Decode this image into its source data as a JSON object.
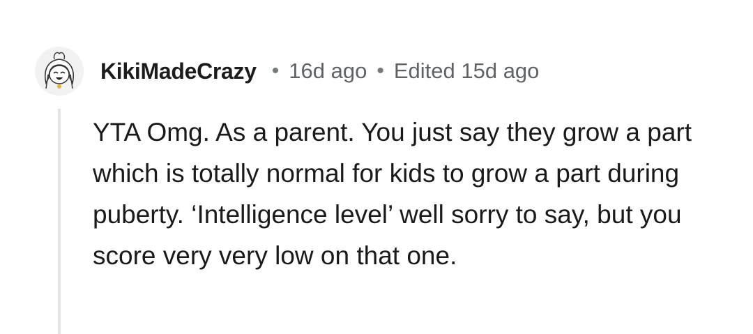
{
  "comment": {
    "author": "KikiMadeCrazy",
    "separator": "•",
    "posted": "16d ago",
    "edited": "Edited 15d ago",
    "body": "YTA Omg. As a parent. You just say they grow a part which is totally normal for kids to grow a part during puberty. ‘Intelligence level’ well sorry to say, but you score very very low on that one."
  },
  "colors": {
    "author": "#1c1c1c",
    "meta": "#5f6368",
    "body": "#1a1a1a",
    "thread_line": "#e4e4e4",
    "background": "#ffffff"
  },
  "icons": {
    "avatar": "anime-girl-avatar-icon"
  }
}
